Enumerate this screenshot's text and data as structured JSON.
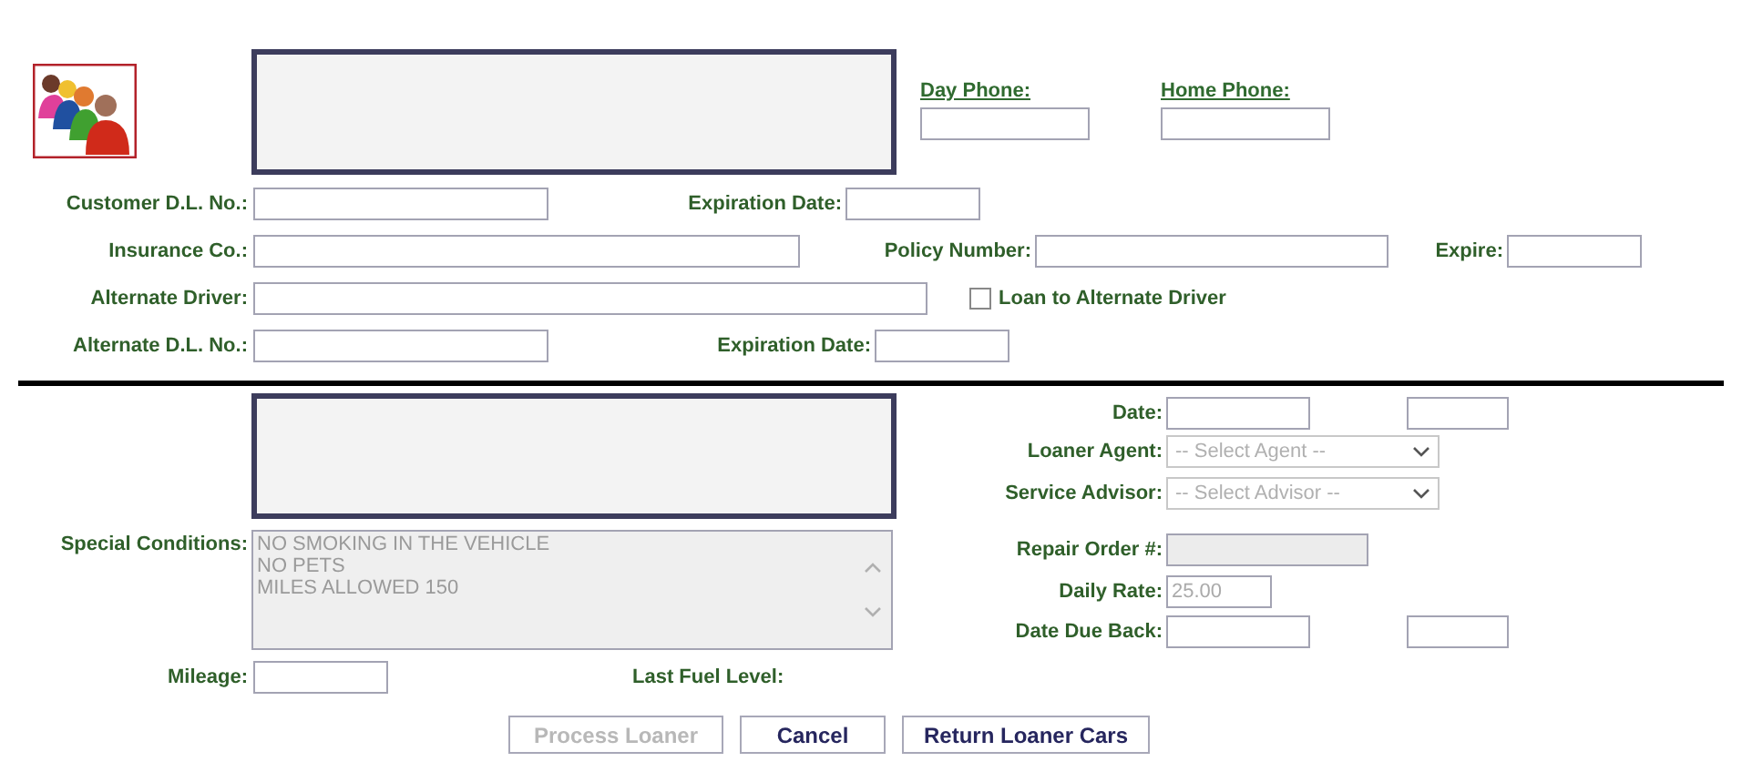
{
  "phones": [
    {
      "label": "Day Phone:"
    },
    {
      "label": "Home Phone:"
    }
  ],
  "customer": {
    "dl_number": {
      "label": "Customer D.L. No.:"
    },
    "dl_expiration": {
      "label": "Expiration Date:"
    },
    "insurance": {
      "label": "Insurance Co.:"
    },
    "policy_number": {
      "label": "Policy Number:"
    },
    "policy_expire": {
      "label": "Expire:"
    },
    "alternate_driver": {
      "label": "Alternate Driver:"
    },
    "loan_to_alternate": {
      "label": "Loan to Alternate Driver",
      "checked": false
    },
    "alternate_dl": {
      "label": "Alternate D.L. No.:"
    },
    "alternate_expiration": {
      "label": "Expiration Date:"
    }
  },
  "loan": {
    "special_conditions": {
      "label": "Special Conditions:",
      "lines": [
        "NO SMOKING IN THE VEHICLE",
        "NO PETS",
        "MILES ALLOWED 150"
      ]
    },
    "mileage": {
      "label": "Mileage:"
    },
    "last_fuel_level": {
      "label": "Last Fuel Level:"
    },
    "date": {
      "label": "Date:"
    },
    "loaner_agent": {
      "label": "Loaner Agent:",
      "placeholder": "-- Select Agent --",
      "disabled": true
    },
    "service_advisor": {
      "label": "Service Advisor:",
      "placeholder": "-- Select Advisor --",
      "disabled": true
    },
    "repair_order": {
      "label": "Repair Order #:",
      "disabled": true
    },
    "daily_rate": {
      "label": "Daily Rate:",
      "value": "25.00"
    },
    "date_due_back": {
      "label": "Date Due Back:"
    }
  },
  "buttons": [
    {
      "label": "Process Loaner",
      "disabled": true
    },
    {
      "label": "Cancel",
      "disabled": false
    },
    {
      "label": "Return Loaner Cars",
      "disabled": false
    }
  ]
}
